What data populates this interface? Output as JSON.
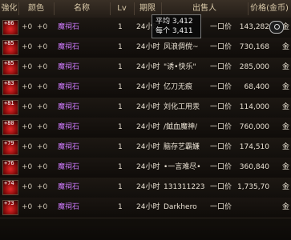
{
  "header": {
    "columns": [
      {
        "label": "強化"
      },
      {
        "label": "颜色"
      },
      {
        "label": "名称"
      },
      {
        "label": "Lv"
      },
      {
        "label": "期限"
      },
      {
        "label": "出售人"
      },
      {
        "label": "价格(金币)"
      }
    ]
  },
  "tooltip": {
    "line1": "平均 3,412",
    "line2": "每个 3,411"
  },
  "rows": [
    {
      "level": "+86",
      "strength": "+0",
      "grade": "+0",
      "name": "魔祠石",
      "lv": "1",
      "duration": "24小时",
      "seller": "",
      "buyout": "一口价",
      "price": "143,282",
      "currency": "金"
    },
    {
      "level": "+85",
      "strength": "+0",
      "grade": "+0",
      "name": "魔祠石",
      "lv": "1",
      "duration": "24小时",
      "seller": "风浪倜傥~",
      "buyout": "一口价",
      "price": "730,168",
      "currency": "金"
    },
    {
      "level": "+85",
      "strength": "+0",
      "grade": "+0",
      "name": "魔祠石",
      "lv": "1",
      "duration": "24小时",
      "seller": "\"诱•快乐\"",
      "buyout": "一口价",
      "price": "285,000",
      "currency": "金"
    },
    {
      "level": "+83",
      "strength": "+0",
      "grade": "+0",
      "name": "魔祠石",
      "lv": "1",
      "duration": "24小时",
      "seller": "亿刀无痕",
      "buyout": "一口价",
      "price": "68,400",
      "currency": "金"
    },
    {
      "level": "+81",
      "strength": "+0",
      "grade": "+0",
      "name": "魔祠石",
      "lv": "1",
      "duration": "24小时",
      "seller": "刘化工用汞",
      "buyout": "一口价",
      "price": "114,000",
      "currency": "金"
    },
    {
      "level": "+80",
      "strength": "+0",
      "grade": "+0",
      "name": "魔祠石",
      "lv": "1",
      "duration": "24小时",
      "seller": "/鉞血魔神/",
      "buyout": "一口价",
      "price": "760,000",
      "currency": "金"
    },
    {
      "level": "+79",
      "strength": "+0",
      "grade": "+0",
      "name": "魔祠石",
      "lv": "1",
      "duration": "24小时",
      "seller": "脑存艺霸嫌",
      "buyout": "一口价",
      "price": "174,510",
      "currency": "金"
    },
    {
      "level": "+76",
      "strength": "+0",
      "grade": "+0",
      "name": "魔祠石",
      "lv": "1",
      "duration": "24小时",
      "seller": "•一言难尽•",
      "buyout": "一口价",
      "price": "360,840",
      "currency": "金"
    },
    {
      "level": "+74",
      "strength": "+0",
      "grade": "+0",
      "name": "魔祠石",
      "lv": "1",
      "duration": "24小时",
      "seller": "131311223",
      "buyout": "一口价",
      "price": "1,735,701",
      "currency": "金"
    },
    {
      "level": "+73",
      "strength": "+0",
      "grade": "+0",
      "name": "魔祠石",
      "lv": "1",
      "duration": "24小时",
      "seller": "Darkhero",
      "buyout": "一口价",
      "price": "",
      "currency": "金"
    }
  ]
}
